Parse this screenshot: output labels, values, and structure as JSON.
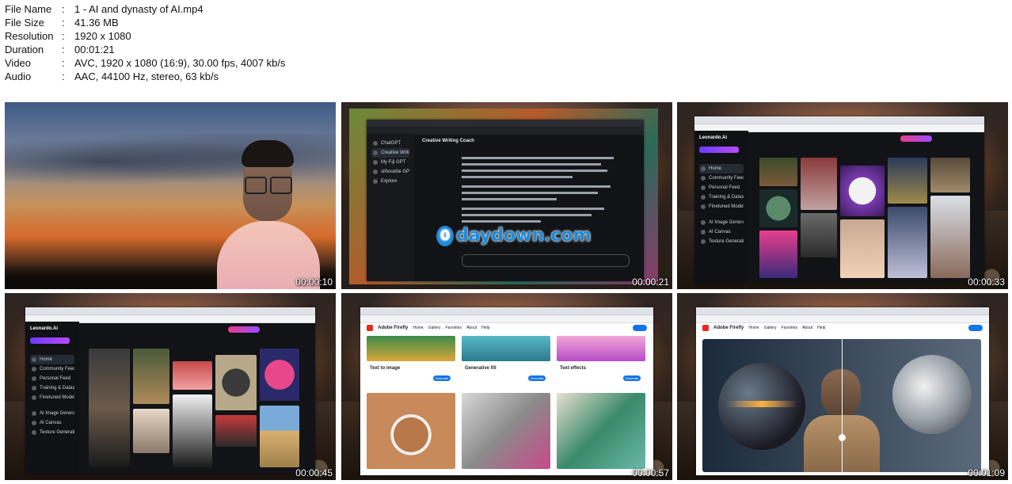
{
  "meta": [
    {
      "key": "File Name",
      "value": "1 - AI and dynasty of AI.mp4"
    },
    {
      "key": "File Size",
      "value": "41.36 MB"
    },
    {
      "key": "Resolution",
      "value": "1920 x 1080"
    },
    {
      "key": "Duration",
      "value": "00:01:21"
    },
    {
      "key": "Video",
      "value": "AVC, 1920 x 1080 (16:9), 30.00 fps, 4007 kb/s"
    },
    {
      "key": "Audio",
      "value": "AAC, 44100 Hz, stereo, 63 kb/s"
    }
  ],
  "separator": ":",
  "thumbnails": [
    {
      "timestamp": "00:00:10"
    },
    {
      "timestamp": "00:00:21",
      "heading": "Creative Writing Coach",
      "watermark": "daydown.com",
      "watermark_prefix": "0",
      "sidebar": [
        "ChatGPT",
        "Creative Writing Coach",
        "My Fiji GPT",
        "silhouette GPT",
        "Explore"
      ]
    },
    {
      "timestamp": "00:00:33",
      "brand": "Leonardo.Ai",
      "sidebar": [
        "Home",
        "Community Feed",
        "Personal Feed",
        "Training & Datasets",
        "Finetuned Models",
        "AI Image Generation",
        "AI Canvas",
        "Texture Generation"
      ]
    },
    {
      "timestamp": "00:00:45",
      "brand": "Leonardo.Ai",
      "sidebar": [
        "Home",
        "Community Feed",
        "Personal Feed",
        "Training & Datasets",
        "Finetuned Models",
        "AI Image Generation",
        "AI Canvas",
        "Texture Generation"
      ]
    },
    {
      "timestamp": "00:00:57",
      "brand": "Adobe Firefly",
      "nav": [
        "Home",
        "Gallery",
        "Favorites",
        "About",
        "Help"
      ],
      "cards": [
        {
          "title": "Text to image",
          "button": "Generate"
        },
        {
          "title": "Generative fill",
          "button": "Generate"
        },
        {
          "title": "Text effects",
          "button": "Generate"
        }
      ]
    },
    {
      "timestamp": "00:01:09",
      "brand": "Adobe Firefly",
      "nav": [
        "Home",
        "Gallery",
        "Favorites",
        "About",
        "Help"
      ]
    }
  ]
}
